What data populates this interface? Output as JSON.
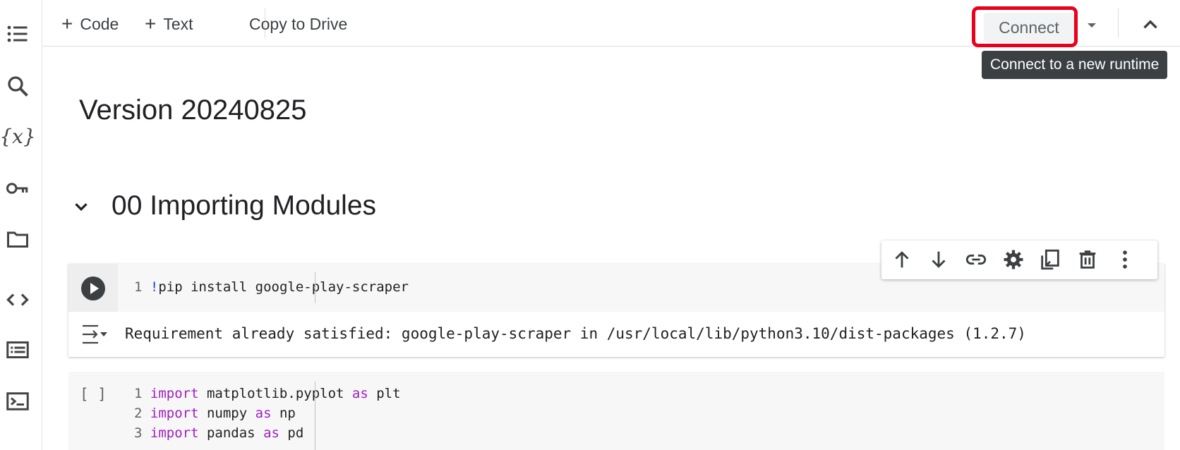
{
  "toolbar": {
    "code_label": "Code",
    "text_label": "Text",
    "copy_label": "Copy to Drive",
    "connect_label": "Connect",
    "tooltip": "Connect to a new runtime"
  },
  "rail_icons": [
    "toc-icon",
    "search-icon",
    "variables-icon",
    "key-icon",
    "folder-icon",
    "code-snippets-icon",
    "command-palette-icon",
    "terminal-icon"
  ],
  "notebook": {
    "title": "Version 20240825",
    "section": "00 Importing Modules",
    "cell1": {
      "line_num": "1",
      "bang": "!",
      "code": "pip install google-play-scraper",
      "output": "Requirement already satisfied: google-play-scraper in /usr/local/lib/python3.10/dist-packages (1.2.7)"
    },
    "cell2": {
      "bracket": "[ ]",
      "lines": [
        {
          "num": "1",
          "kw1": "import",
          "mid": " matplotlib.pyplot ",
          "kw2": "as",
          "end": " plt"
        },
        {
          "num": "2",
          "kw1": "import",
          "mid": " numpy ",
          "kw2": "as",
          "end": " np"
        },
        {
          "num": "3",
          "kw1": "import",
          "mid": " pandas ",
          "kw2": "as",
          "end": " pd"
        }
      ]
    }
  },
  "cell_toolbar": [
    "move-up-icon",
    "move-down-icon",
    "link-icon",
    "settings-icon",
    "mirror-cell-icon",
    "delete-icon",
    "more-icon"
  ],
  "colors": {
    "highlight": "#e8001c",
    "keyword": "#a020c0",
    "bang": "#1a47c8"
  }
}
